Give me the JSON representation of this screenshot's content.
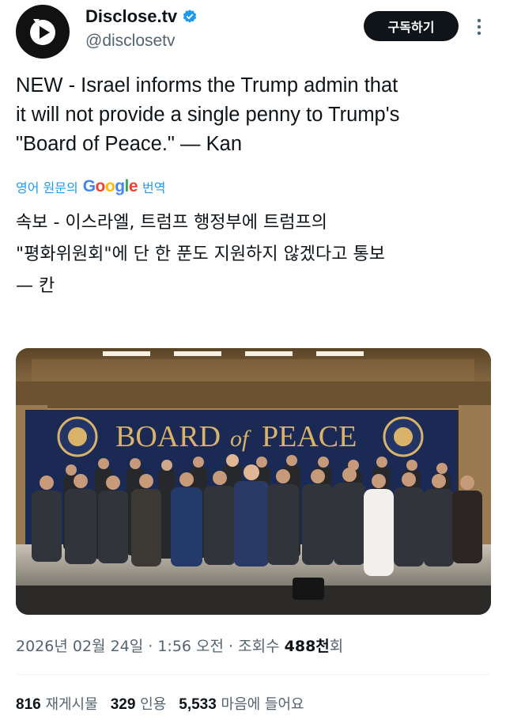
{
  "account": {
    "display_name": "Disclose.tv",
    "handle": "@disclosetv",
    "subscribe_label": "구독하기",
    "verified_color": "#1d9bf0"
  },
  "tweet": {
    "lines": [
      "NEW - Israel informs the Trump admin that",
      "it will not provide a single penny to Trump's",
      "\"Board of Peace.\" — Kan"
    ]
  },
  "translation": {
    "prefix": "영어 원문의",
    "brand": "Google",
    "suffix": "번역",
    "lines": [
      "속보 - 이스라엘, 트럼프 행정부에 트럼프의",
      "\"평화위원회\"에 단 한 푼도 지원하지 않겠다고 통보",
      "— 칸"
    ]
  },
  "media": {
    "banner_text": "BOARD of PEACE",
    "banner_word1": "BOARD",
    "banner_word2": "of",
    "banner_word3": "PEACE"
  },
  "meta": {
    "datetime": "2026년 02월 24일 · 1:56 오전 · 조회수 ",
    "views": "488천",
    "views_suffix": "회"
  },
  "stats": {
    "retweets_count": "816",
    "retweets_label": "재게시물",
    "quotes_count": "329",
    "quotes_label": "인용",
    "likes_count": "5,533",
    "likes_label": "마음에 들어요"
  },
  "colors": {
    "text_primary": "#0f1419",
    "text_secondary": "#536471",
    "link_blue": "#1d9bf0",
    "banner_navy": "#1b2a55",
    "banner_gold": "#d9b36a"
  },
  "icons": [
    "disclose-logo-icon",
    "verified-badge-icon",
    "more-options-icon",
    "google-logo"
  ]
}
